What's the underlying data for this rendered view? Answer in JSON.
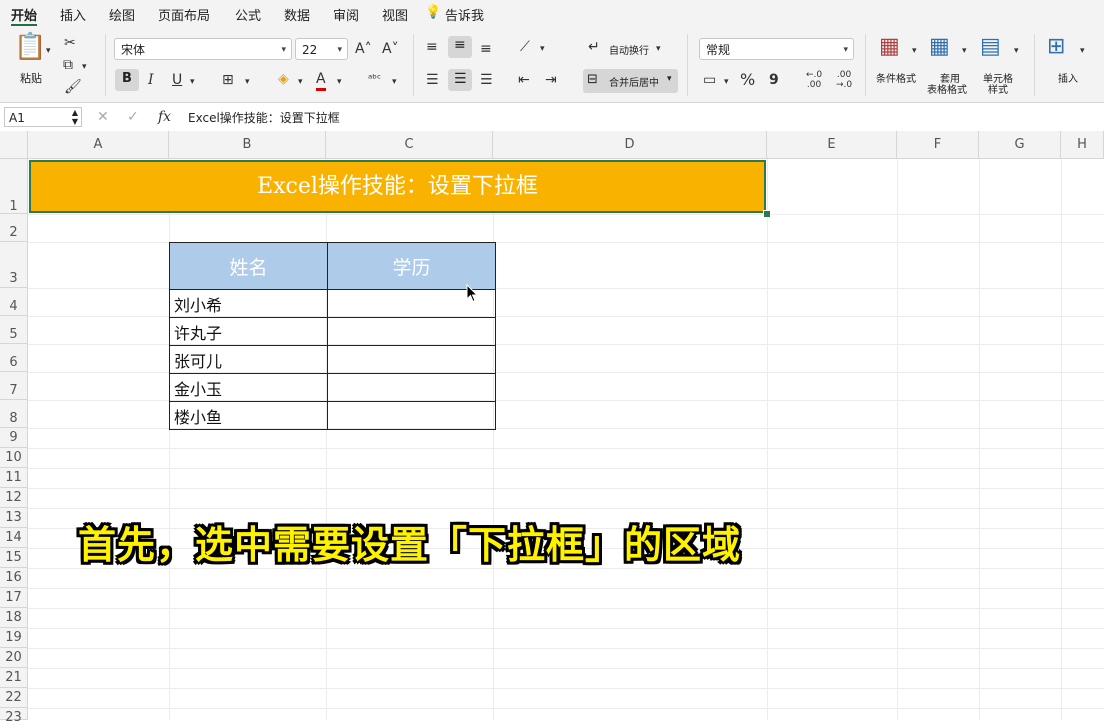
{
  "menu": {
    "tabs": [
      "开始",
      "插入",
      "绘图",
      "页面布局",
      "公式",
      "数据",
      "审阅",
      "视图"
    ],
    "tell_me": "告诉我"
  },
  "ribbon": {
    "paste_label": "粘贴",
    "font_name": "宋体",
    "font_size": "22",
    "bold": "B",
    "italic": "I",
    "underline": "U",
    "wrap_text": "自动换行",
    "merge_center": "合并后居中",
    "number_format": "常规",
    "percent": "%",
    "comma": "9",
    "cond_format": "条件格式",
    "table_format_line1": "套用",
    "table_format_line2": "表格格式",
    "cell_style_line1": "单元格",
    "cell_style_line2": "样式",
    "insert": "插入",
    "dec_increase": "←.0\n.00",
    "dec_decrease": ".00\n→.0"
  },
  "formula_bar": {
    "name_box": "A1",
    "fx": "fx",
    "formula": "Excel操作技能：设置下拉框"
  },
  "columns": [
    "A",
    "B",
    "C",
    "D",
    "E",
    "F",
    "G",
    "H"
  ],
  "rows": [
    "1",
    "2",
    "3",
    "4",
    "5",
    "6",
    "7",
    "8",
    "9",
    "10",
    "11",
    "12",
    "13",
    "14",
    "15",
    "16",
    "17",
    "18",
    "19",
    "20",
    "21",
    "22",
    "23"
  ],
  "title_cell": "Excel操作技能：设置下拉框",
  "table": {
    "headers": [
      "姓名",
      "学历"
    ],
    "names": [
      "刘小希",
      "许丸子",
      "张可儿",
      "金小玉",
      "楼小鱼"
    ]
  },
  "caption": "首先，选中需要设置「下拉框」的区域",
  "colors": {
    "title_fill": "#f9b200",
    "header_fill": "#aecbe9",
    "accent": "#1e7145",
    "caption": "#fff200"
  }
}
